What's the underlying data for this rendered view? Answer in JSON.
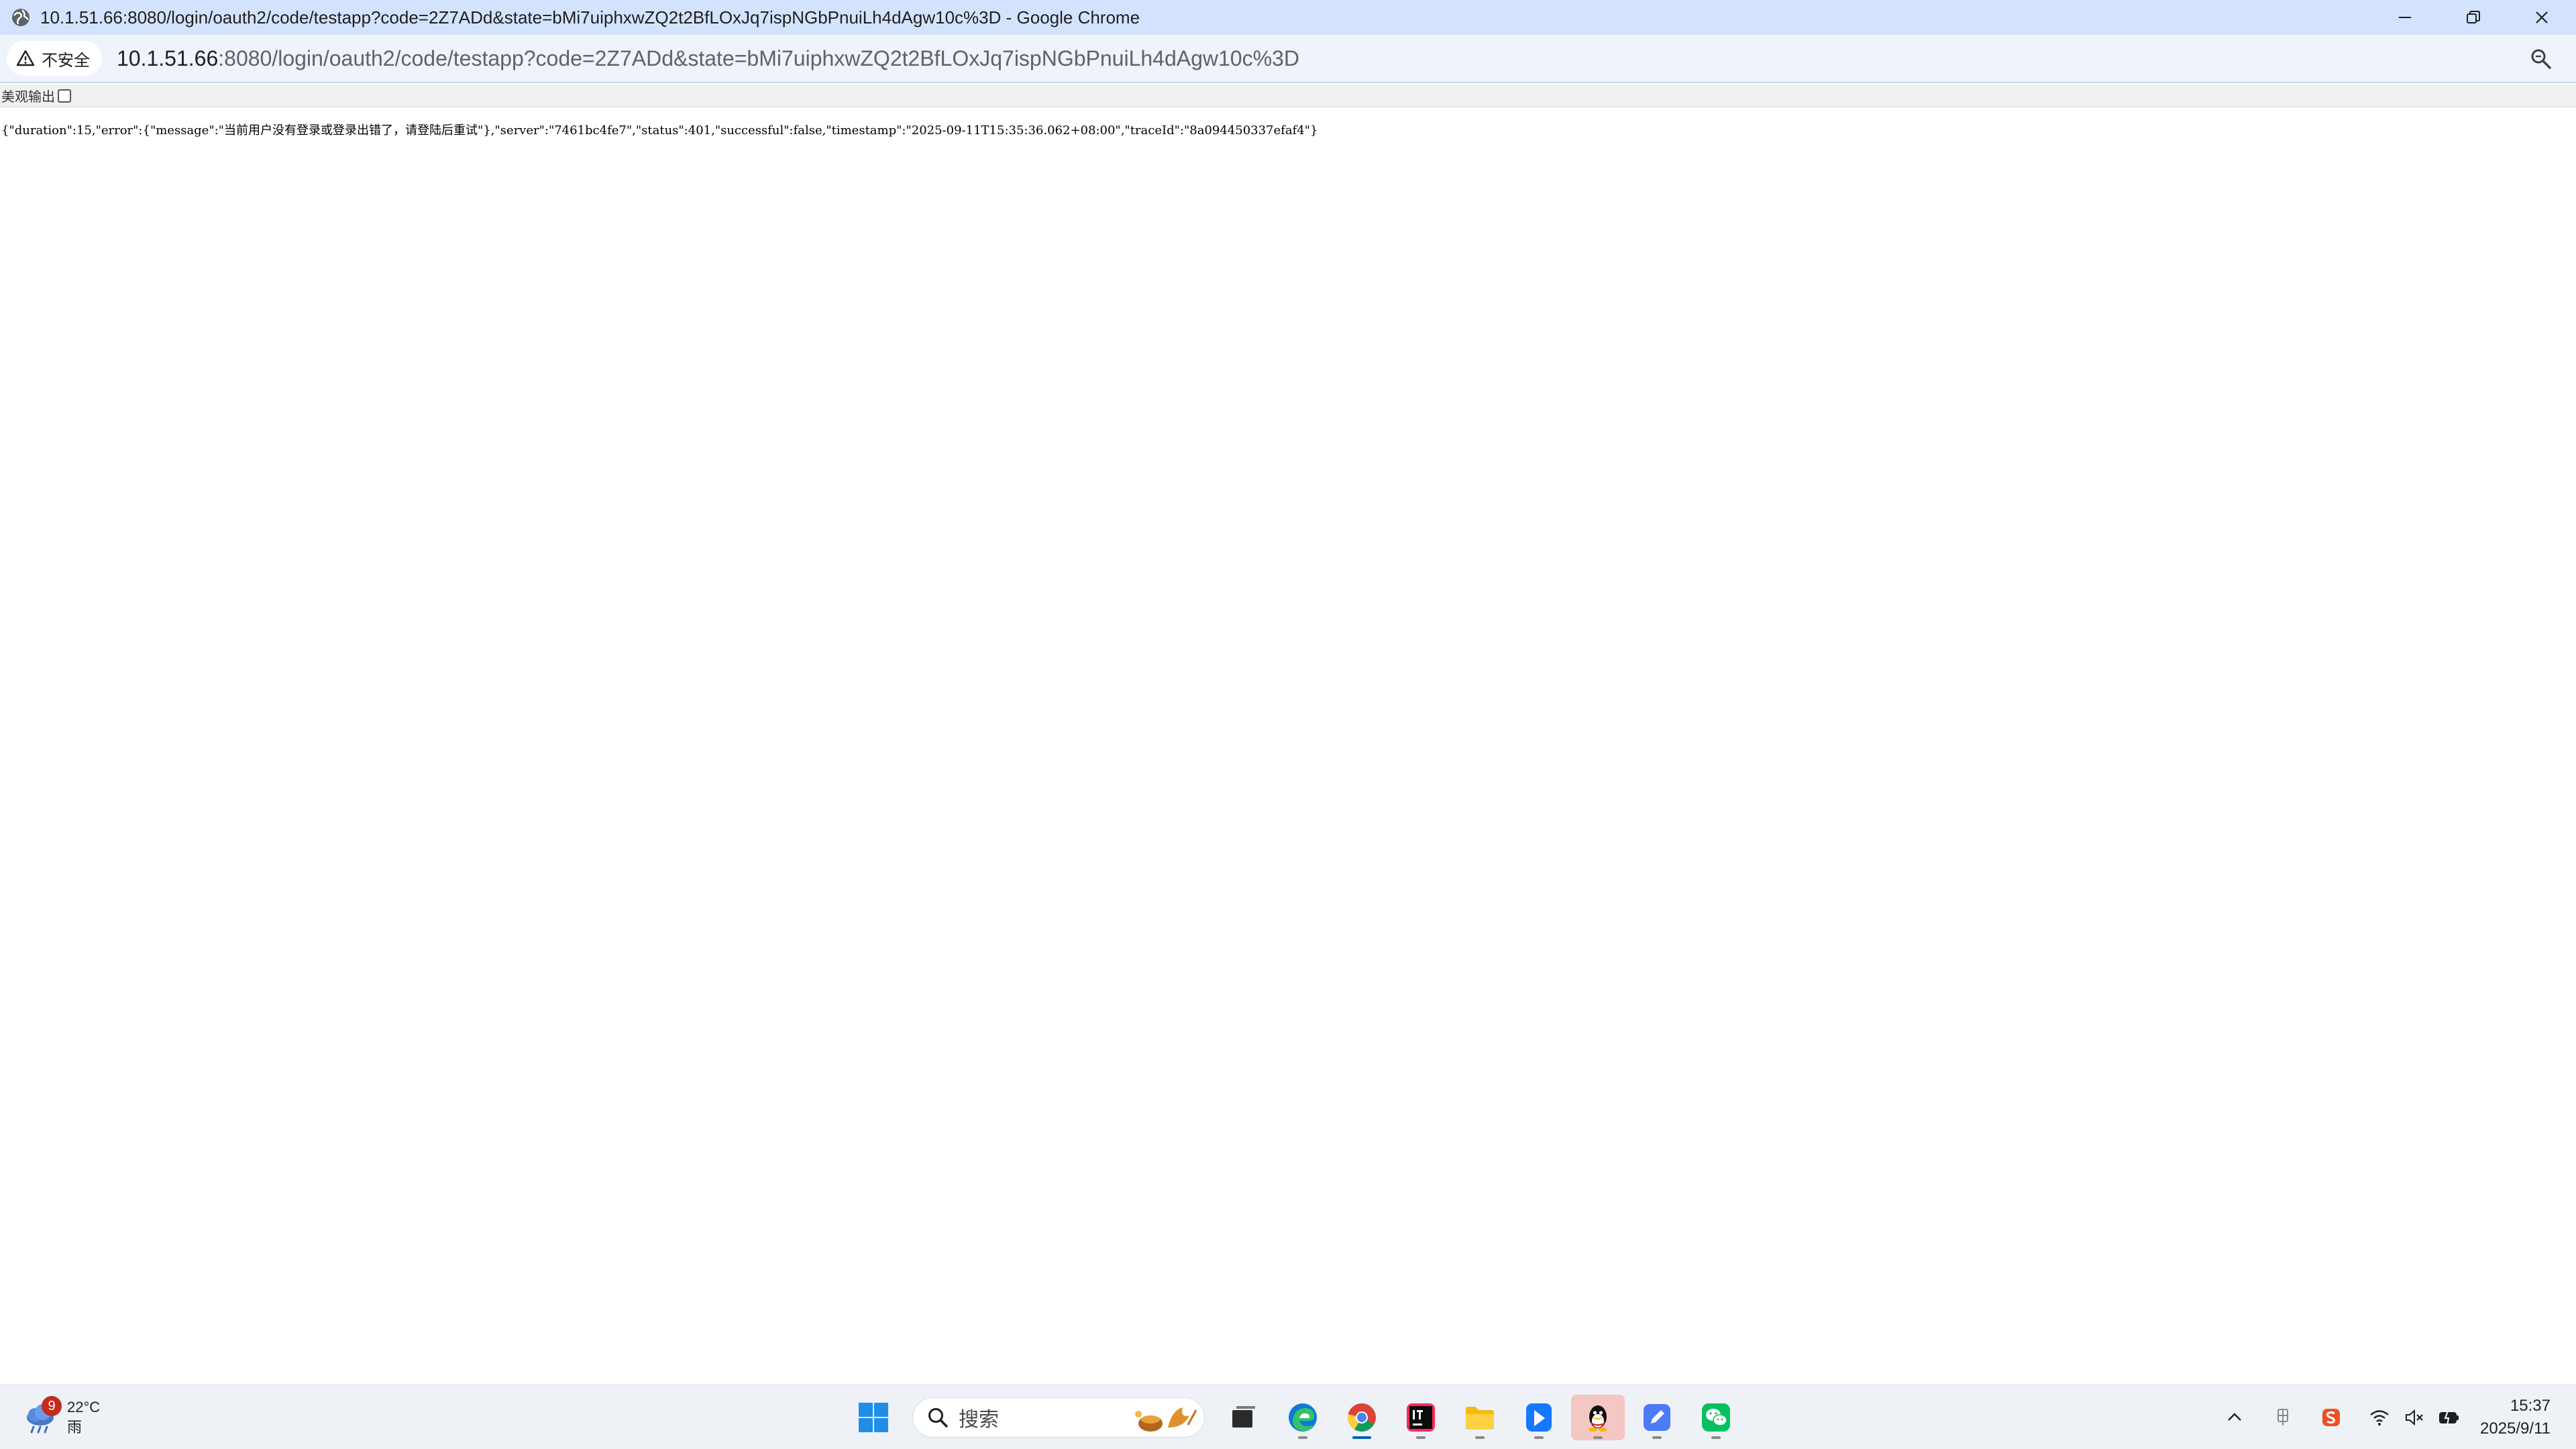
{
  "window": {
    "title": "10.1.51.66:8080/login/oauth2/code/testapp?code=2Z7ADd&state=bMi7uiphxwZQ2t2BfLOxJq7ispNGbPnuiLh4dAgw10c%3D - Google Chrome"
  },
  "addressbar": {
    "security_label": "不安全",
    "url_host": "10.1.51.66",
    "url_rest": ":8080/login/oauth2/code/testapp?code=2Z7ADd&state=bMi7uiphxwZQ2t2BfLOxJq7ispNGbPnuiLh4dAgw10c%3D"
  },
  "page": {
    "pretty_print_label": "美观输出",
    "json_text": "{\"duration\":15,\"error\":{\"message\":\"当前用户没有登录或登录出错了，请登陆后重试\"},\"server\":\"7461bc4fe7\",\"status\":401,\"successful\":false,\"timestamp\":\"2025-09-11T15:35:36.062+08:00\",\"traceId\":\"8a094450337efaf4\"}"
  },
  "taskbar": {
    "weather": {
      "badge": "9",
      "temperature": "22°C",
      "condition": "雨"
    },
    "search_placeholder": "搜索",
    "clock": {
      "time": "15:37",
      "date": "2025/9/11"
    }
  },
  "colors": {
    "titlebar_bg": "#d3e3fd",
    "addressbar_bg": "#eef3fc",
    "taskbar_bg": "#eef2f7",
    "badge_red": "#c42b1c",
    "focus_blue": "#005fb8"
  }
}
